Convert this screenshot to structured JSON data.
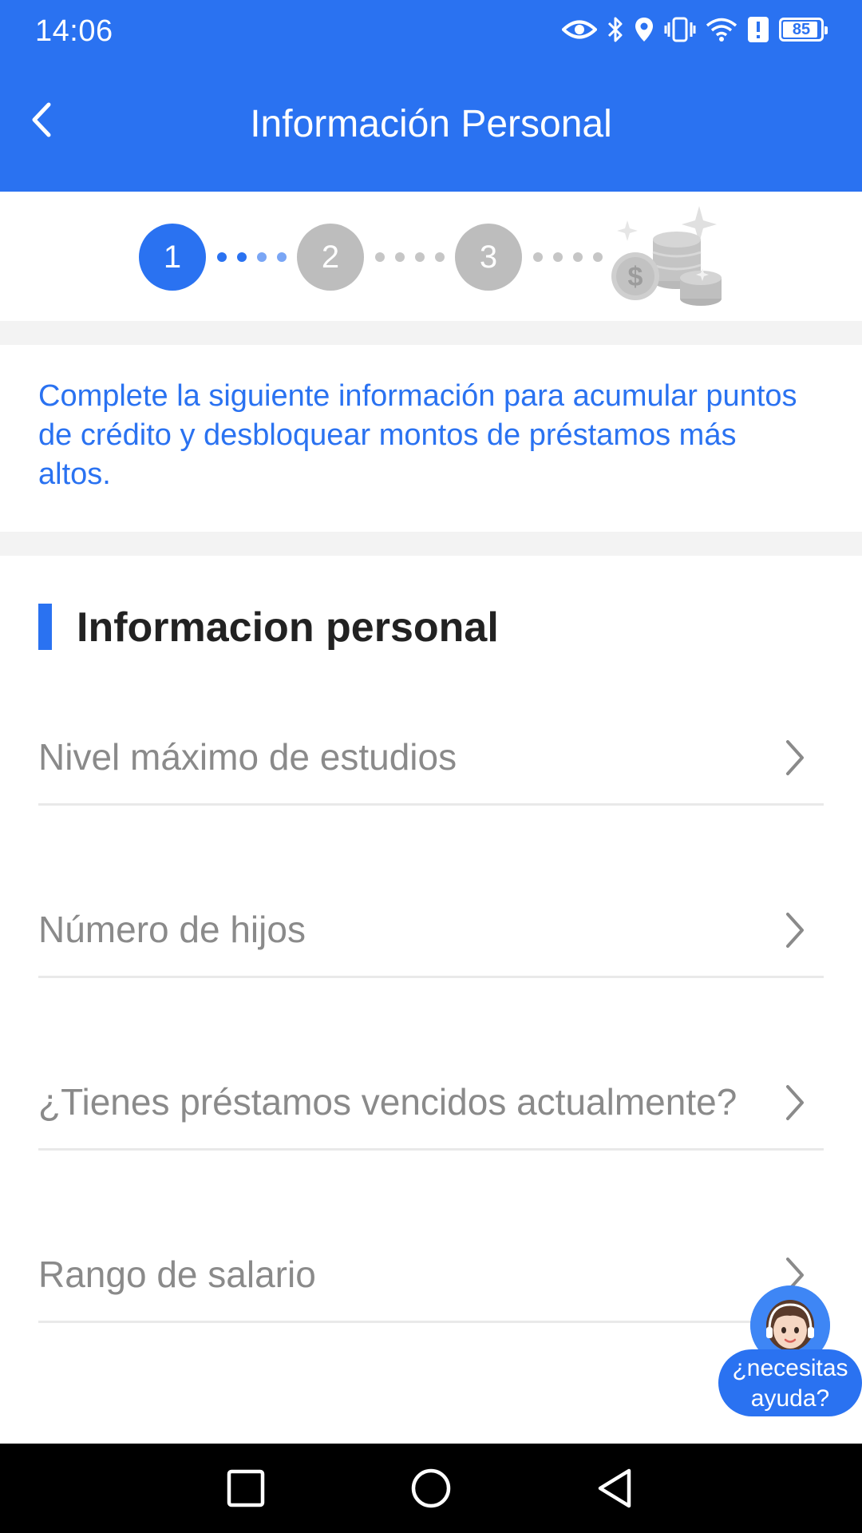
{
  "status_bar": {
    "time": "14:06",
    "battery_level": "85",
    "icons": [
      "eye-icon",
      "bluetooth-icon",
      "location-icon",
      "vibrate-icon",
      "wifi-icon",
      "alert-icon",
      "battery-icon"
    ]
  },
  "header": {
    "title": "Información Personal",
    "back_icon": "chevron-left-icon"
  },
  "stepper": {
    "steps": [
      "1",
      "2",
      "3"
    ],
    "current_step": 1,
    "final_icon": "coins-icon",
    "colors": {
      "active": "#2a72f1",
      "inactive": "#bdbdbd"
    }
  },
  "intro": {
    "text": "Complete la siguiente información para acumular puntos de crédito y desbloquear montos de préstamos más altos."
  },
  "section": {
    "title": "Informacion personal"
  },
  "form": {
    "rows": [
      {
        "label": "Nivel máximo de estudios"
      },
      {
        "label": "Número de hijos"
      },
      {
        "label": "¿Tienes préstamos vencidos actualmente?"
      },
      {
        "label": "Rango de salario"
      }
    ]
  },
  "help": {
    "line1": "¿necesitas",
    "line2": "ayuda?"
  },
  "nav": {
    "buttons": [
      "recent-apps-icon",
      "home-icon",
      "back-icon"
    ]
  },
  "colors": {
    "primary": "#2a72f1",
    "label_gray": "#8a8a8a",
    "divider": "#e9e9e9",
    "separator": "#f3f3f3"
  }
}
